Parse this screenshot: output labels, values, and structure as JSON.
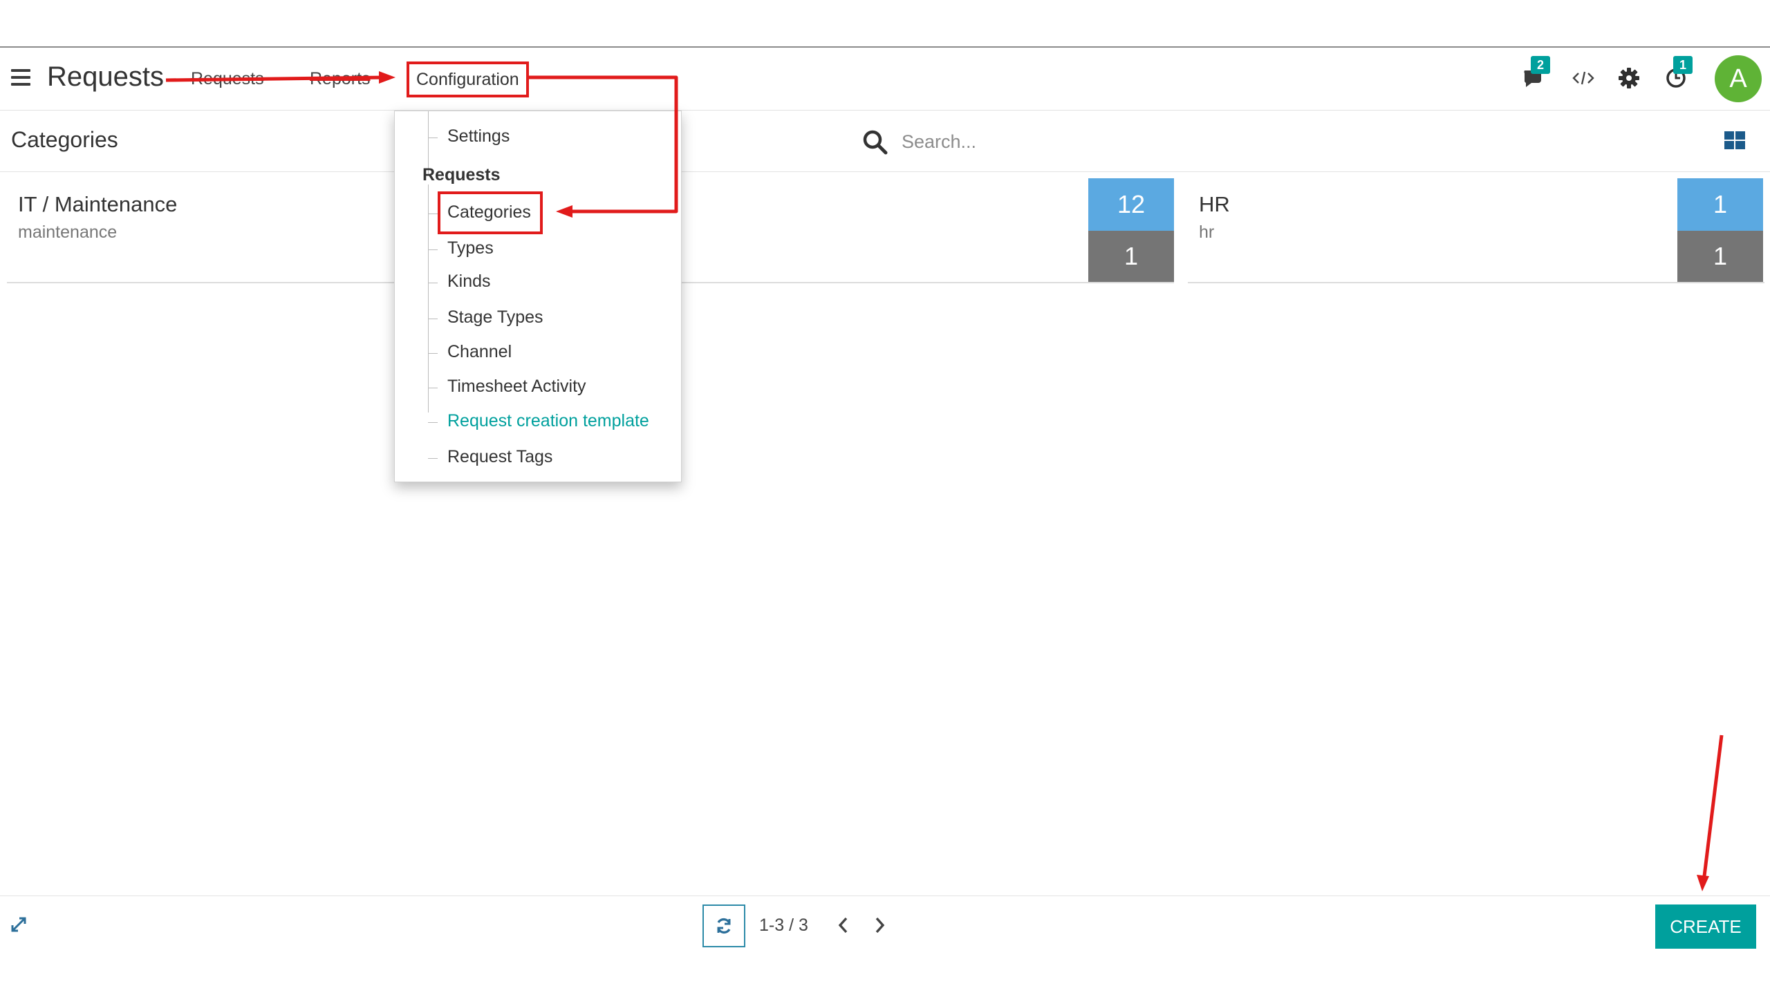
{
  "navbar": {
    "title": "Requests",
    "menu": [
      "Requests",
      "Reports",
      "Configuration"
    ],
    "badges": {
      "messages": "2",
      "activities": "1"
    },
    "avatar_letter": "A"
  },
  "control_panel": {
    "breadcrumb": "Categories",
    "search_placeholder": "Search..."
  },
  "cards": [
    {
      "name": "IT / Maintenance",
      "code": "maintenance",
      "count_top": "12",
      "count_bottom": "1"
    },
    {
      "name": "HR",
      "code": "hr",
      "count_top": "1",
      "count_bottom": "1"
    }
  ],
  "dropdown": {
    "settings": "Settings",
    "section": "Requests",
    "items": [
      "Categories",
      "Types",
      "Kinds",
      "Stage Types",
      "Channel",
      "Timesheet Activity",
      "Request creation template",
      "Request Tags"
    ]
  },
  "pager": {
    "value": "1-3 / 3"
  },
  "footer": {
    "create_label": "CREATE"
  },
  "colors": {
    "accent": "#00a09d",
    "annotation": "#e11b1b",
    "stat_blue": "#5ba9e1",
    "stat_gray": "#757575",
    "avatar": "#5fb336"
  }
}
